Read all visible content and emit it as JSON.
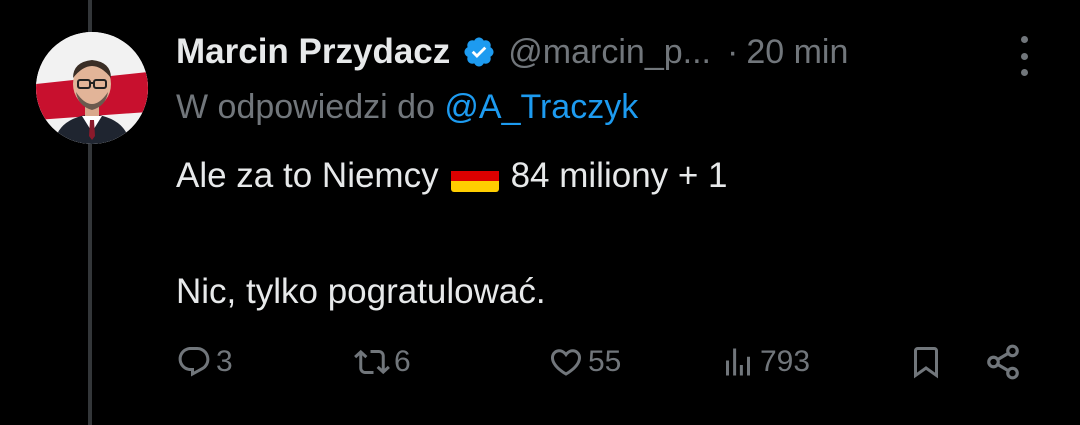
{
  "tweet": {
    "author_name": "Marcin Przydacz",
    "verified": true,
    "handle": "@marcin_p...",
    "separator": "·",
    "time": "20 min",
    "reply_prefix": "W odpowiedzi do",
    "reply_handle": "@A_Traczyk",
    "text_line1_before": "Ale za to Niemcy",
    "text_line1_flag": "german-flag",
    "text_line1_after": "84 miliony + 1",
    "text_line2": "Nic, tylko pogratulować."
  },
  "actions": {
    "replies": "3",
    "reposts": "6",
    "likes": "55",
    "views": "793"
  },
  "colors": {
    "background": "#000000",
    "text_primary": "#e7e9ea",
    "text_secondary": "#71767b",
    "accent": "#1d9bf0",
    "thread_line": "#333639"
  },
  "icons": {
    "verified": "verified-badge-icon",
    "more": "more-options-icon",
    "reply": "reply-icon",
    "repost": "repost-icon",
    "like": "heart-icon",
    "views": "views-chart-icon",
    "bookmark": "bookmark-icon",
    "share": "share-icon"
  }
}
